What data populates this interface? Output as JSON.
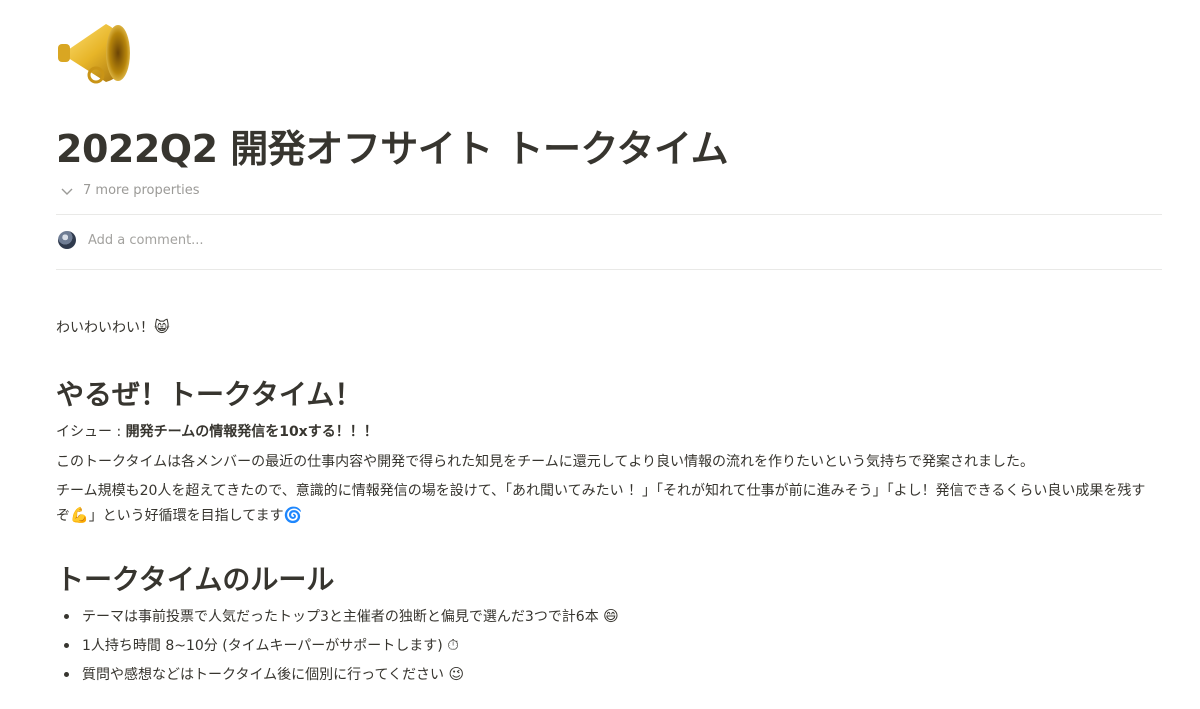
{
  "page": {
    "icon": "megaphone-icon",
    "title": "2022Q2 開発オフサイト トークタイム",
    "properties_toggle": "7 more properties",
    "comment_placeholder": "Add a comment..."
  },
  "content": {
    "intro": "わいわいわい！",
    "intro_emoji": "😸",
    "section1": {
      "heading": "やるぜ！トークタイム！",
      "issue_prefix": "イシュー : ",
      "issue_bold": "開発チームの情報発信を10xする！！！",
      "paragraph1": "このトークタイムは各メンバーの最近の仕事内容や開発で得られた知見をチームに還元してより良い情報の流れを作りたいという気持ちで発案されました。",
      "paragraph2_a": "チーム規模も20人を超えてきたので、意識的に情報発信の場を設けて、「あれ聞いてみたい ！」「それが知れて仕事が前に進みそう」「よし！発信できるくらい良い成果を残すぞ",
      "paragraph2_emoji1": "💪",
      "paragraph2_b": "」という好循環を目指してます",
      "paragraph2_emoji2": "🌀"
    },
    "section2": {
      "heading": "トークタイムのルール",
      "rules": [
        {
          "text": "テーマは事前投票で人気だったトップ3と主催者の独断と偏見で選んだ3つで計6本 ",
          "emoji": "😄"
        },
        {
          "text": "1人持ち時間 8~10分 (タイムキーパーがサポートします) ",
          "emoji": "⏱"
        },
        {
          "text": "質問や感想などはトークタイム後に個別に行ってください ",
          "emoji": "😉"
        }
      ]
    }
  }
}
